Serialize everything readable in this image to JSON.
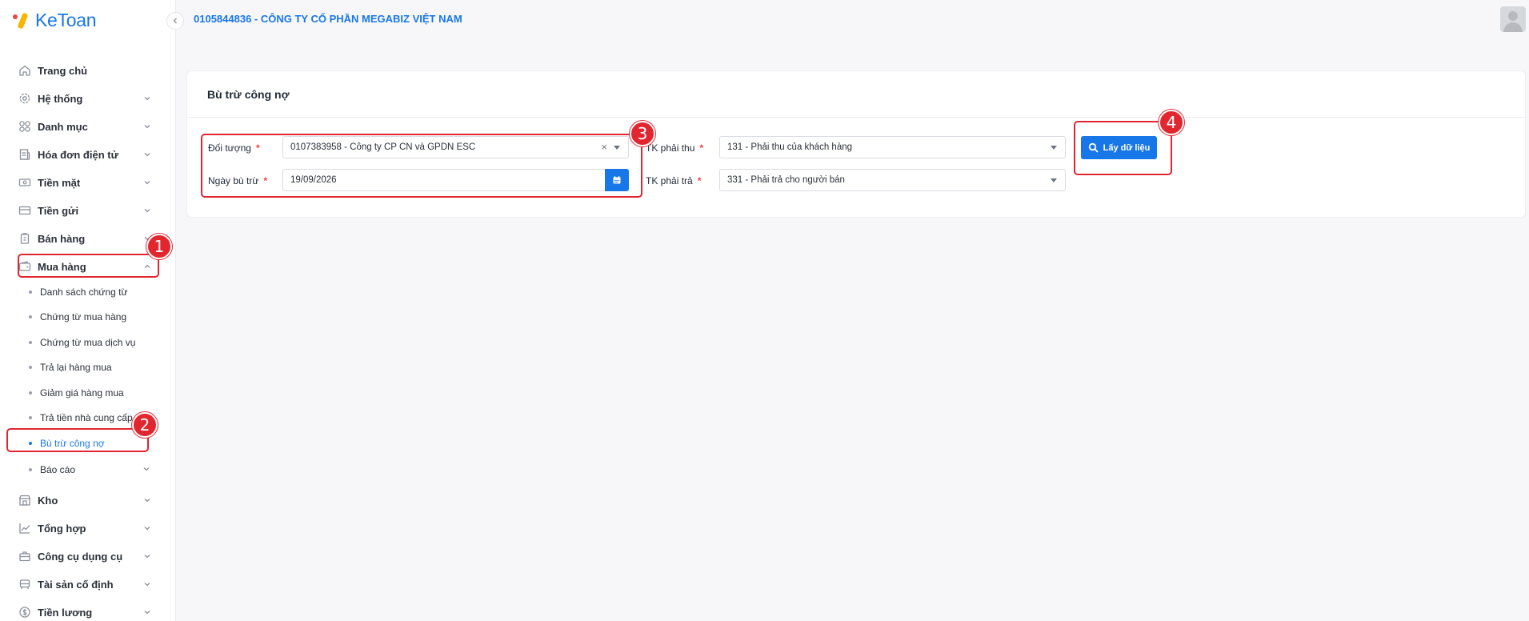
{
  "brand": {
    "name": "KeToan"
  },
  "header": {
    "company": "0105844836 - CÔNG TY CỔ PHẦN MEGABIZ VIỆT NAM"
  },
  "sidebar": {
    "items_top": [
      {
        "label": "Trang chủ",
        "icon": "home-icon",
        "chevron": false
      },
      {
        "label": "Hệ thống",
        "icon": "gear-icon",
        "chevron": true
      },
      {
        "label": "Danh mục",
        "icon": "grid-icon",
        "chevron": true
      },
      {
        "label": "Hóa đơn điện tử",
        "icon": "invoice-icon",
        "chevron": true
      },
      {
        "label": "Tiền mặt",
        "icon": "cash-icon",
        "chevron": true
      },
      {
        "label": "Tiền gửi",
        "icon": "card-icon",
        "chevron": true
      },
      {
        "label": "Bán hàng",
        "icon": "sale-icon",
        "chevron": true
      },
      {
        "label": "Mua hàng",
        "icon": "wallet-icon",
        "chevron": "up"
      }
    ],
    "sub_items": [
      {
        "label": "Danh sách chứng từ"
      },
      {
        "label": "Chứng từ mua hàng"
      },
      {
        "label": "Chứng từ mua dịch vụ"
      },
      {
        "label": "Trả lại hàng mua"
      },
      {
        "label": "Giảm giá hàng mua"
      },
      {
        "label": "Trả tiền nhà cung cấp"
      },
      {
        "label": "Bù trừ công nợ",
        "active": true
      },
      {
        "label": "Báo cáo",
        "chevron": true
      }
    ],
    "items_bottom": [
      {
        "label": "Kho",
        "icon": "store-icon"
      },
      {
        "label": "Tổng hợp",
        "icon": "chart-icon"
      },
      {
        "label": "Công cụ dụng cụ",
        "icon": "tool-icon"
      },
      {
        "label": "Tài sản cố định",
        "icon": "car-icon"
      },
      {
        "label": "Tiền lương",
        "icon": "salary-icon"
      }
    ]
  },
  "card": {
    "title": "Bù trừ công nợ",
    "fields": {
      "doi_tuong": {
        "label": "Đối tượng",
        "value": "0107383958 - Công ty CP CN và GPDN ESC"
      },
      "ngay_bu_tru": {
        "label": "Ngày bù trừ",
        "value": "19/09/2026"
      },
      "tk_phai_thu": {
        "label": "TK phải thu",
        "value": "131 - Phải thu của khách hàng"
      },
      "tk_phai_tra": {
        "label": "TK phải trả",
        "value": "331 - Phải trả cho người bán"
      }
    },
    "required_mark": "*",
    "clear_glyph": "×",
    "fetch_button": "Lấy dữ liệu"
  },
  "annotations": [
    "1",
    "2",
    "3",
    "4"
  ],
  "colors": {
    "primary": "#1877e8",
    "annotation": "#e1262f",
    "required": "#ef4444"
  }
}
